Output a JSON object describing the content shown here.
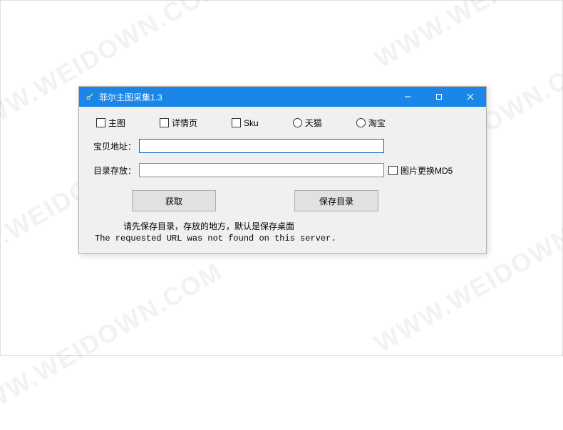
{
  "watermark": "WWW.WEIDOWN.COM",
  "window": {
    "title": "菲尔主图采集1.3",
    "icon_name": "key-icon"
  },
  "options": {
    "main_image": "主图",
    "detail_page": "详情页",
    "sku": "Sku",
    "tmall": "天猫",
    "taobao": "淘宝"
  },
  "fields": {
    "url_label": "宝贝地址：",
    "url_value": "",
    "dir_label": "目录存放：",
    "dir_value": "",
    "replace_md5": "图片更换MD5"
  },
  "buttons": {
    "fetch": "获取",
    "save_dir": "保存目录"
  },
  "hint": "请先保存目录，存放的地方，默认是保存桌面",
  "error": "The requested URL was not found on this server."
}
